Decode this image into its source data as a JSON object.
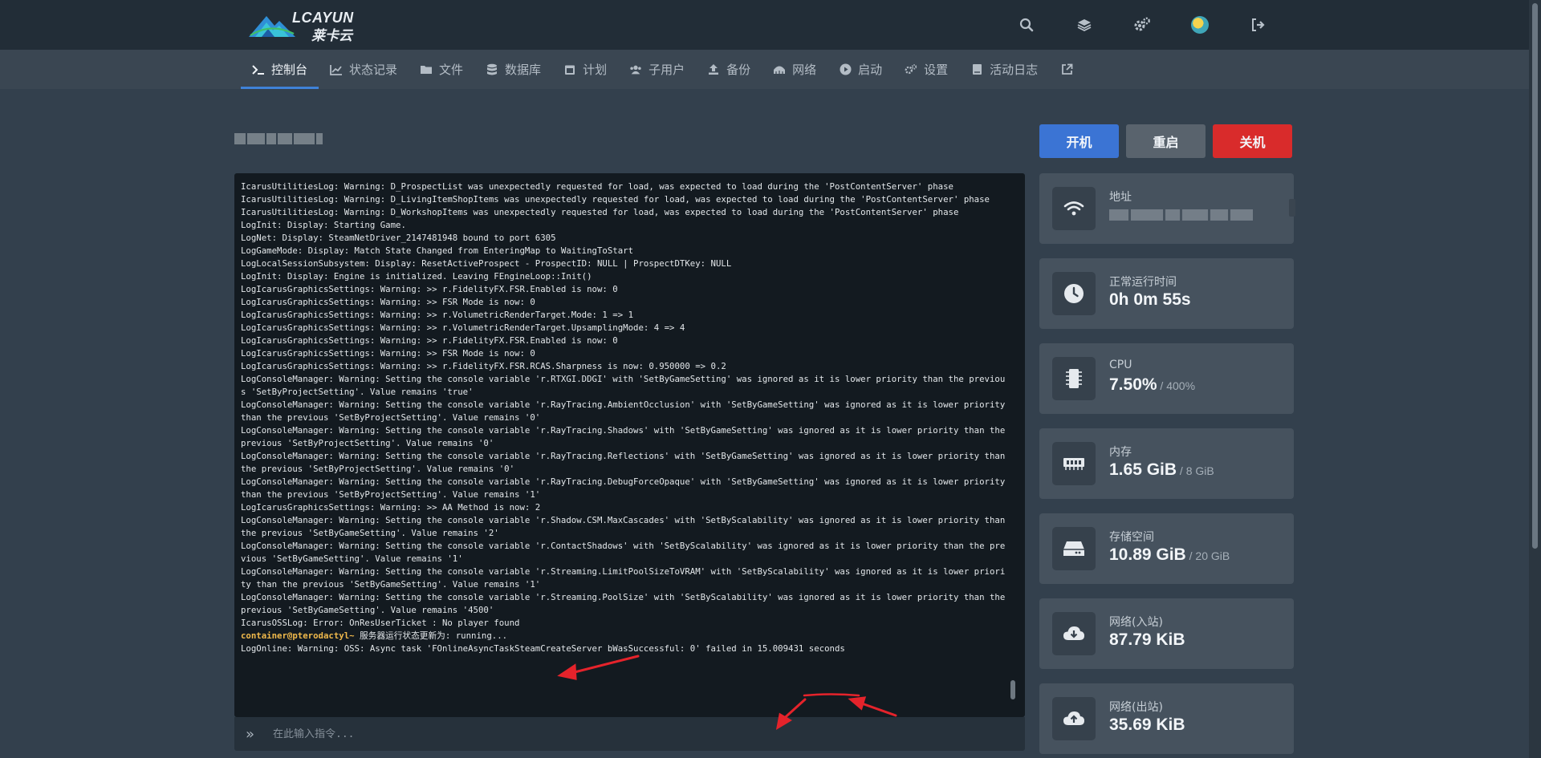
{
  "brand": {
    "name_en": "LCAYUN",
    "name_cn": "莱卡云"
  },
  "topbar": {
    "icons": [
      "search-icon",
      "layers-icon",
      "cogs-icon",
      "avatar",
      "sign-out-icon"
    ]
  },
  "nav": {
    "items": [
      {
        "label": "控制台",
        "icon": "terminal-icon",
        "active": true
      },
      {
        "label": "状态记录",
        "icon": "chart-icon"
      },
      {
        "label": "文件",
        "icon": "folder-icon"
      },
      {
        "label": "数据库",
        "icon": "database-icon"
      },
      {
        "label": "计划",
        "icon": "calendar-icon"
      },
      {
        "label": "子用户",
        "icon": "users-icon"
      },
      {
        "label": "备份",
        "icon": "upload-icon"
      },
      {
        "label": "网络",
        "icon": "network-icon"
      },
      {
        "label": "启动",
        "icon": "play-icon"
      },
      {
        "label": "设置",
        "icon": "cogs-icon"
      },
      {
        "label": "活动日志",
        "icon": "book-icon"
      },
      {
        "label": "",
        "icon": "external-link-icon"
      }
    ]
  },
  "power": {
    "start": "开机",
    "restart": "重启",
    "stop": "关机"
  },
  "console": {
    "prompt": "container@pterodactyl~",
    "lines": [
      "IcarusUtilitiesLog: Warning: D_ProspectList was unexpectedly requested for load, was expected to load during the 'PostContentServer' phase",
      "IcarusUtilitiesLog: Warning: D_LivingItemShopItems was unexpectedly requested for load, was expected to load during the 'PostContentServer' phase",
      "IcarusUtilitiesLog: Warning: D_WorkshopItems was unexpectedly requested for load, was expected to load during the 'PostContentServer' phase",
      "LogInit: Display: Starting Game.",
      "LogNet: Display: SteamNetDriver_2147481948 bound to port 6305",
      "LogGameMode: Display: Match State Changed from EnteringMap to WaitingToStart",
      "LogLocalSessionSubsystem: Display: ResetActiveProspect - ProspectID: NULL | ProspectDTKey: NULL",
      "LogInit: Display: Engine is initialized. Leaving FEngineLoop::Init()",
      "LogIcarusGraphicsSettings: Warning: >> r.FidelityFX.FSR.Enabled is now: 0",
      "LogIcarusGraphicsSettings: Warning: >> FSR Mode is now: 0",
      "LogIcarusGraphicsSettings: Warning: >> r.VolumetricRenderTarget.Mode: 1 => 1",
      "LogIcarusGraphicsSettings: Warning: >> r.VolumetricRenderTarget.UpsamplingMode: 4 => 4",
      "LogIcarusGraphicsSettings: Warning: >> r.FidelityFX.FSR.Enabled is now: 0",
      "LogIcarusGraphicsSettings: Warning: >> FSR Mode is now: 0",
      "LogIcarusGraphicsSettings: Warning: >> r.FidelityFX.FSR.RCAS.Sharpness is now: 0.950000 => 0.2",
      "LogConsoleManager: Warning: Setting the console variable 'r.RTXGI.DDGI' with 'SetByGameSetting' was ignored as it is lower priority than the previous 'SetByProjectSetting'. Value remains 'true'",
      "LogConsoleManager: Warning: Setting the console variable 'r.RayTracing.AmbientOcclusion' with 'SetByGameSetting' was ignored as it is lower priority than the previous 'SetByProjectSetting'. Value remains '0'",
      "LogConsoleManager: Warning: Setting the console variable 'r.RayTracing.Shadows' with 'SetByGameSetting' was ignored as it is lower priority than the previous 'SetByProjectSetting'. Value remains '0'",
      "LogConsoleManager: Warning: Setting the console variable 'r.RayTracing.Reflections' with 'SetByGameSetting' was ignored as it is lower priority than the previous 'SetByProjectSetting'. Value remains '0'",
      "LogConsoleManager: Warning: Setting the console variable 'r.RayTracing.DebugForceOpaque' with 'SetByGameSetting' was ignored as it is lower priority than the previous 'SetByProjectSetting'. Value remains '1'",
      "LogIcarusGraphicsSettings: Warning: >> AA Method is now: 2",
      "LogConsoleManager: Warning: Setting the console variable 'r.Shadow.CSM.MaxCascades' with 'SetByScalability' was ignored as it is lower priority than the previous 'SetByGameSetting'. Value remains '2'",
      "LogConsoleManager: Warning: Setting the console variable 'r.ContactShadows' with 'SetByScalability' was ignored as it is lower priority than the previous 'SetByGameSetting'. Value remains '1'",
      "LogConsoleManager: Warning: Setting the console variable 'r.Streaming.LimitPoolSizeToVRAM' with 'SetByScalability' was ignored as it is lower priority than the previous 'SetByGameSetting'. Value remains '1'",
      "LogConsoleManager: Warning: Setting the console variable 'r.Streaming.PoolSize' with 'SetByScalability' was ignored as it is lower priority than the previous 'SetByGameSetting'. Value remains '4500'",
      "IcarusOSSLog: Error: OnResUserTicket : No player found",
      {
        "prompt": true,
        "text": " 服务器运行状态更新为: running..."
      },
      "LogOnline: Warning: OSS: Async task 'FOnlineAsyncTaskSteamCreateServer bWasSuccessful: 0' failed in 15.009431 seconds"
    ],
    "input_placeholder": "在此输入指令..."
  },
  "stats": {
    "address": {
      "label": "地址",
      "icon": "wifi-icon"
    },
    "uptime": {
      "label": "正常运行时间",
      "value": "0h 0m 55s",
      "icon": "clock-icon"
    },
    "cpu": {
      "label": "CPU",
      "value": "7.50%",
      "limit": " / 400%",
      "icon": "chip-icon"
    },
    "memory": {
      "label": "内存",
      "value": "1.65 GiB",
      "limit": " / 8 GiB",
      "icon": "memory-icon"
    },
    "disk": {
      "label": "存储空间",
      "value": "10.89 GiB",
      "limit": " / 20 GiB",
      "icon": "hdd-icon"
    },
    "net_in": {
      "label": "网络(入站)",
      "value": "87.79 KiB",
      "icon": "cloud-download-icon"
    },
    "net_out": {
      "label": "网络(出站)",
      "value": "35.69 KiB",
      "icon": "cloud-upload-icon"
    }
  },
  "colors": {
    "accent": "#3f82d8",
    "start": "#3b74d4",
    "restart": "#59636d",
    "stop": "#d92b2b",
    "prompt": "#f0b94b",
    "annotation": "#e5232b"
  }
}
